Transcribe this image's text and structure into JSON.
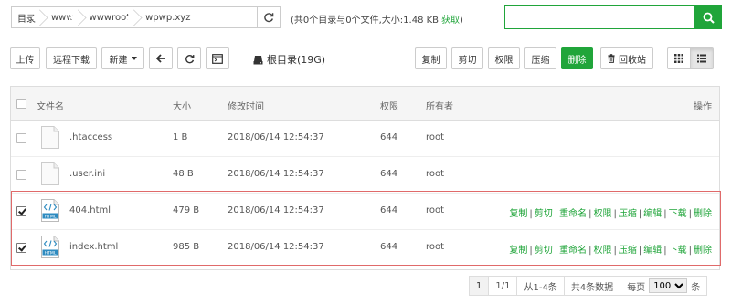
{
  "breadcrumb": {
    "items": [
      "目录",
      "www",
      "wwwroot",
      "wpwp.xyz"
    ]
  },
  "dir_info": {
    "text": "(共0个目录与0个文件,大小:1.48 KB",
    "link": "获取",
    "close": ")"
  },
  "search": {
    "value": "",
    "placeholder": ""
  },
  "toolbar": {
    "upload": "上传",
    "remote_download": "远程下载",
    "new": "新建",
    "root_dir": "根目录(19G)",
    "copy": "复制",
    "cut": "剪切",
    "permission": "权限",
    "compress": "压缩",
    "delete": "删除",
    "recycle": "回收站"
  },
  "table": {
    "headers": {
      "name": "文件名",
      "size": "大小",
      "mtime": "修改时间",
      "perm": "权限",
      "owner": "所有者",
      "ops": "操作"
    },
    "rows": [
      {
        "name": ".htaccess",
        "size": "1 B",
        "mtime": "2018/06/14 12:54:37",
        "perm": "644",
        "owner": "root",
        "checked": false,
        "type": "file"
      },
      {
        "name": ".user.ini",
        "size": "48 B",
        "mtime": "2018/06/14 12:54:37",
        "perm": "644",
        "owner": "root",
        "checked": false,
        "type": "file"
      },
      {
        "name": "404.html",
        "size": "479 B",
        "mtime": "2018/06/14 12:54:37",
        "perm": "644",
        "owner": "root",
        "checked": true,
        "type": "html"
      },
      {
        "name": "index.html",
        "size": "985 B",
        "mtime": "2018/06/14 12:54:37",
        "perm": "644",
        "owner": "root",
        "checked": true,
        "type": "html"
      }
    ],
    "actions": [
      "复制",
      "剪切",
      "重命名",
      "权限",
      "压缩",
      "编辑",
      "下载",
      "删除"
    ]
  },
  "pager": {
    "current": "1",
    "pages": "1/1",
    "range": "从1-4条",
    "total": "共4条数据",
    "per_page_label": "每页",
    "per_page_value": "100",
    "unit": "条"
  },
  "colors": {
    "accent": "#20a53a",
    "selection_border": "#e06a6a"
  }
}
